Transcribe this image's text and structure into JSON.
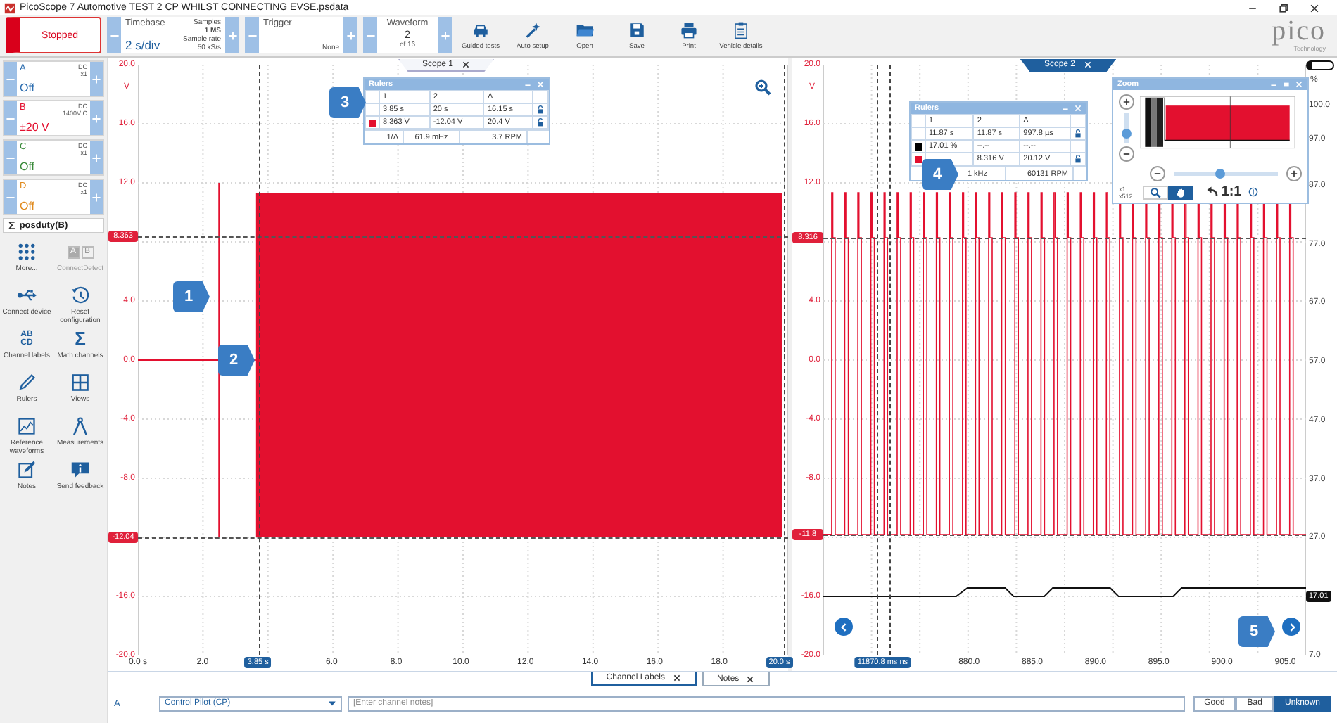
{
  "window": {
    "title": "PicoScope 7 Automotive TEST 2 CP WHILST CONNECTING EVSE.psdata"
  },
  "toolbar": {
    "run_button": {
      "label": "Stopped"
    },
    "timebase": {
      "label": "Timebase",
      "value": "2 s/div",
      "samples_label": "Samples",
      "samples": "1 MS",
      "rate_label": "Sample rate",
      "rate": "50 kS/s"
    },
    "trigger": {
      "label": "Trigger",
      "mode": "None"
    },
    "waveform": {
      "label": "Waveform",
      "current": "2",
      "total": "of 16"
    },
    "tools": [
      {
        "kind": "car",
        "label": "Guided tests"
      },
      {
        "kind": "wand",
        "label": "Auto setup"
      },
      {
        "kind": "folder",
        "label": "Open"
      },
      {
        "kind": "disk",
        "label": "Save"
      },
      {
        "kind": "printer",
        "label": "Print"
      },
      {
        "kind": "clipboard",
        "label": "Vehicle details"
      }
    ],
    "logo": {
      "wordmark": "pico",
      "tagline": "Technology"
    }
  },
  "channels": [
    {
      "letter": "A",
      "coupling": "DC",
      "probe": "x1",
      "range": "Off",
      "color": "#2f6fb0"
    },
    {
      "letter": "B",
      "coupling": "DC",
      "probe": "1400V C",
      "range": "±20 V",
      "color": "#e3102f"
    },
    {
      "letter": "C",
      "coupling": "DC",
      "probe": "x1",
      "range": "Off",
      "color": "#3a8a3a"
    },
    {
      "letter": "D",
      "coupling": "DC",
      "probe": "x1",
      "range": "Off",
      "color": "#e08a1e"
    }
  ],
  "math_channel": {
    "symbol": "Σ",
    "label": "posduty(B)"
  },
  "connect_detect_keys": [
    "A",
    "B"
  ],
  "sidebar_tools": [
    {
      "kind": "dots",
      "label": "More...",
      "disabled": false
    },
    {
      "kind": "keys",
      "label": "ConnectDetect",
      "disabled": true
    },
    {
      "kind": "usb",
      "label": "Connect device",
      "disabled": false
    },
    {
      "kind": "reset",
      "label": "Reset configuration",
      "disabled": false
    },
    {
      "kind": "glyph",
      "label": "Channel labels",
      "disabled": false,
      "glyph": "AB CD"
    },
    {
      "kind": "glyph",
      "label": "Math channels",
      "disabled": false,
      "glyph": "Σ"
    },
    {
      "kind": "ruler",
      "label": "Rulers",
      "disabled": false
    },
    {
      "kind": "views",
      "label": "Views",
      "disabled": false
    },
    {
      "kind": "reference",
      "label": "Reference waveforms",
      "disabled": false
    },
    {
      "kind": "calipers",
      "label": "Measurements",
      "disabled": false
    },
    {
      "kind": "notes",
      "label": "Notes",
      "disabled": false
    },
    {
      "kind": "feedback",
      "label": "Send feedback",
      "disabled": false
    }
  ],
  "scopes": [
    {
      "tab": {
        "label": "Scope 1",
        "selected": false
      },
      "y_unit": "V",
      "y_ticks": [
        "20.0",
        "16.0",
        "12.0",
        "4.0",
        "0.0",
        "-4.0",
        "-8.0",
        "-16.0",
        "-20.0"
      ],
      "x_ticks": [
        "0.0 s",
        "2.0",
        "6.0",
        "8.0",
        "10.0",
        "12.0",
        "14.0",
        "16.0",
        "18.0"
      ],
      "v_ruler_tags": [
        "3.85 s",
        "20.0 s"
      ],
      "h_ruler_tags": [
        "8.363",
        "-12.04"
      ],
      "callouts": [
        "1",
        "2",
        "3"
      ],
      "rulers_panel": {
        "title": "Rulers",
        "columns": [
          "1",
          "2",
          "Δ"
        ],
        "rows": [
          {
            "cells": [
              "3.85 s",
              "20 s",
              "16.15 s"
            ],
            "lock": true
          },
          {
            "color": "#e3102f",
            "cells": [
              "8.363 V",
              "-12.04 V",
              "20.4 V"
            ],
            "lock": true
          }
        ],
        "footer": {
          "label": "1/Δ",
          "frequency": "61.9 mHz",
          "rpm": "3.7 RPM"
        }
      }
    },
    {
      "tab": {
        "label": "Scope 2",
        "selected": true
      },
      "y_unit": "V",
      "y_ticks": [
        "20.0",
        "16.0",
        "12.0",
        "4.0",
        "0.0",
        "-4.0",
        "-8.0",
        "-16.0",
        "-20.0"
      ],
      "x_ticks": [
        "880.0",
        "885.0",
        "890.0",
        "895.0",
        "900.0",
        "905.0"
      ],
      "v_ruler_tags": [
        "11870.8 ms ns"
      ],
      "h_ruler_tags": [
        "8.316",
        "-11.8"
      ],
      "right_unit": "%",
      "right_ticks": [
        "100.0",
        "97.0",
        "87.0",
        "77.0",
        "67.0",
        "57.0",
        "47.0",
        "37.0",
        "27.0",
        "7.0"
      ],
      "value_tag": "17.01",
      "callouts": [
        "4",
        "5"
      ],
      "rulers_panel": {
        "title": "Rulers",
        "columns": [
          "1",
          "2",
          "Δ"
        ],
        "rows": [
          {
            "cells": [
              "11.87 s",
              "11.87 s",
              "997.8 µs"
            ],
            "lock": true
          },
          {
            "color": "#000000",
            "cells": [
              "17.01 %",
              "--.--",
              "--.--"
            ],
            "lock": false
          },
          {
            "color": "#e3102f",
            "cells": [
              null,
              "8.316 V",
              "20.12 V"
            ],
            "lock": true
          }
        ],
        "footer": {
          "frequency": "1 kHz",
          "rpm": "60131 RPM"
        }
      },
      "zoom_panel": {
        "title": "Zoom",
        "sliders": [
          {
            "kind": "vertical",
            "level": 0.3
          },
          {
            "kind": "horizontal",
            "level": 0.45
          }
        ],
        "x_factor": "x1",
        "y_factor": "x512",
        "reset_label": "1:1",
        "tools": [
          {
            "kind": "zoom",
            "selected": false
          },
          {
            "kind": "pan",
            "selected": true
          }
        ]
      }
    }
  ],
  "bottom": {
    "tabs": [
      {
        "label": "Channel Labels",
        "selected": true
      },
      {
        "label": "Notes",
        "selected": false
      }
    ],
    "channel": "A",
    "label_select": "Control Pilot (CP)",
    "notes_placeholder": "[Enter channel notes]",
    "verdicts": [
      {
        "label": "Good",
        "selected": false
      },
      {
        "label": "Bad",
        "selected": false
      },
      {
        "label": "Unknown",
        "selected": true
      }
    ]
  }
}
